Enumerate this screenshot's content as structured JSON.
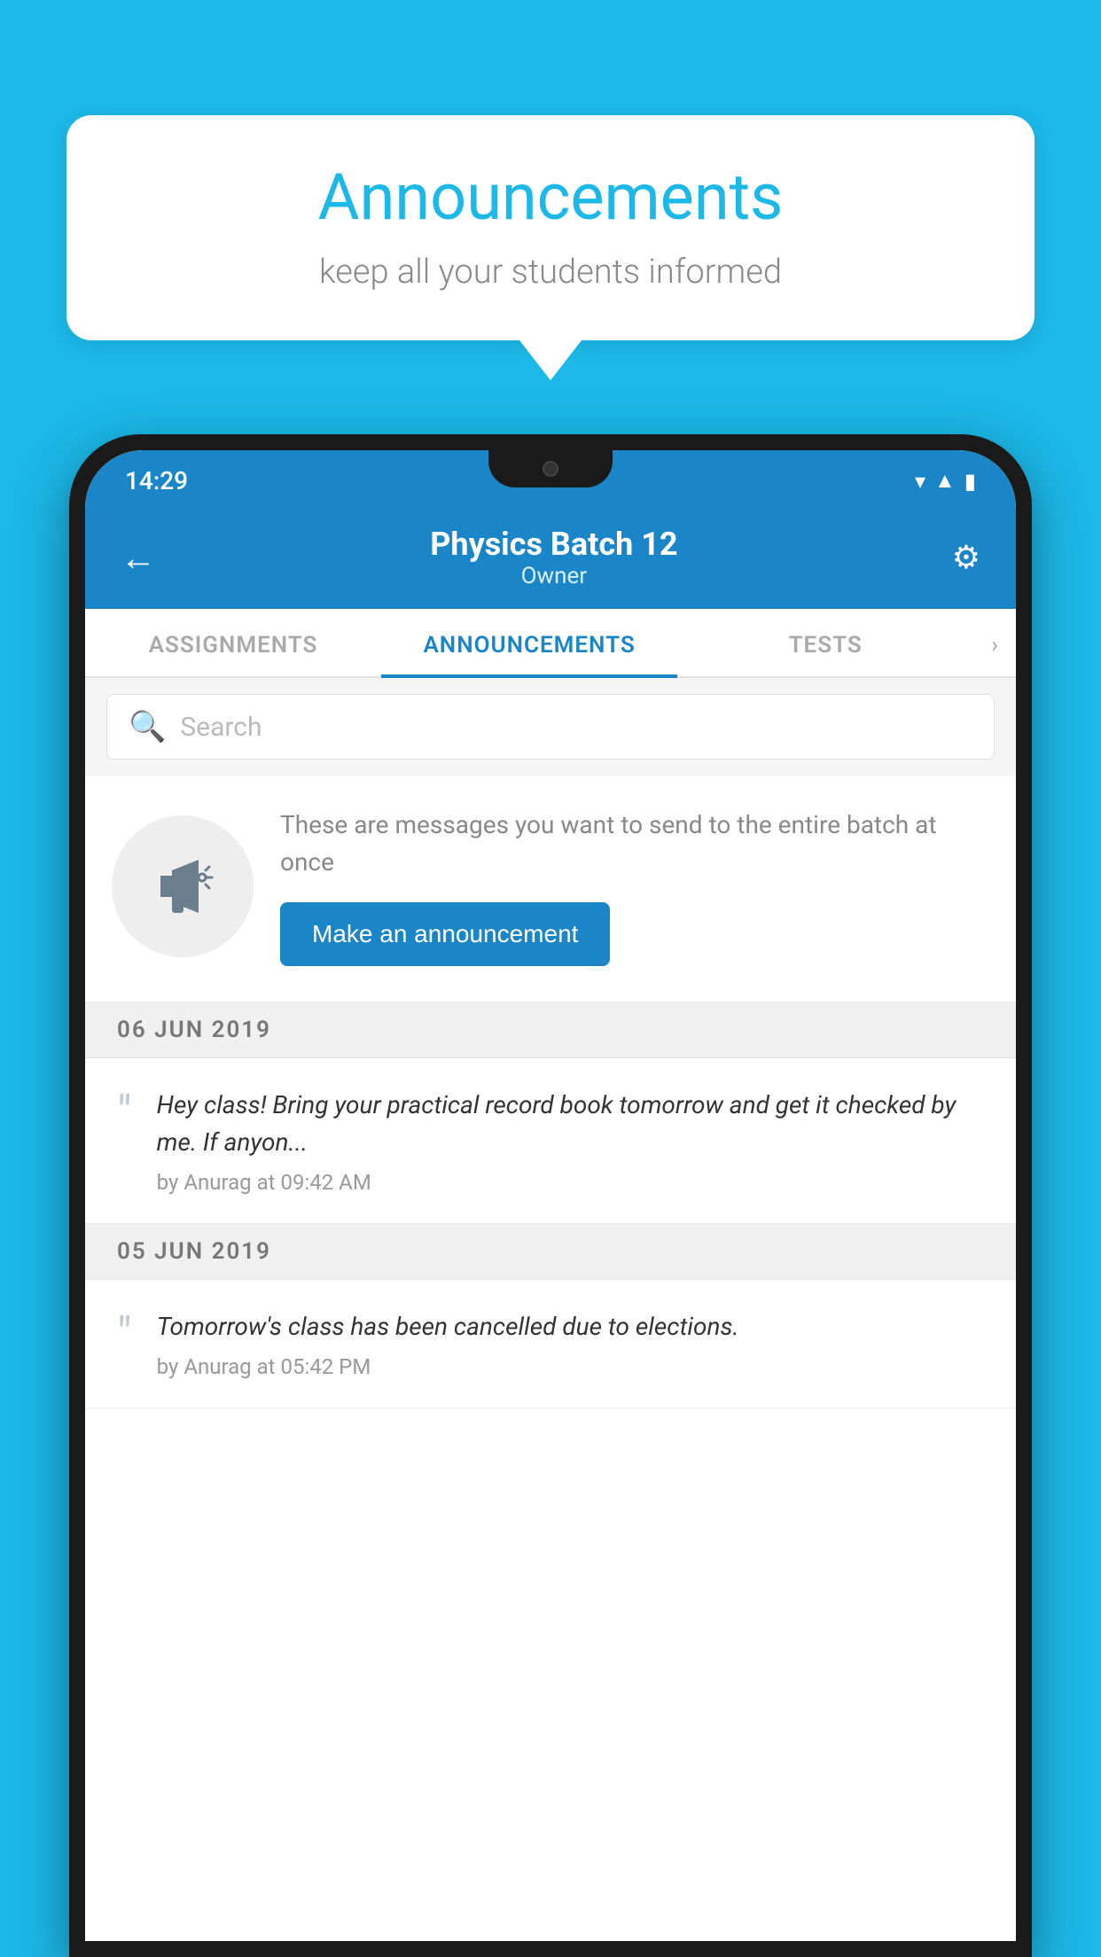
{
  "background_color": "#1cb8e8",
  "speech_bubble": {
    "title": "Announcements",
    "subtitle": "keep all your students informed"
  },
  "status_bar": {
    "time": "14:29",
    "icons": [
      "wifi",
      "signal",
      "battery"
    ]
  },
  "app_bar": {
    "title": "Physics Batch 12",
    "subtitle": "Owner",
    "back_label": "←",
    "gear_label": "⚙"
  },
  "tabs": [
    {
      "label": "ASSIGNMENTS",
      "active": false
    },
    {
      "label": "ANNOUNCEMENTS",
      "active": true
    },
    {
      "label": "TESTS",
      "active": false
    },
    {
      "label": "›",
      "active": false
    }
  ],
  "search": {
    "placeholder": "Search"
  },
  "promo_card": {
    "description": "These are messages you want to send to the entire batch at once",
    "button_label": "Make an announcement"
  },
  "announcements": [
    {
      "date": "06  JUN  2019",
      "items": [
        {
          "text": "Hey class! Bring your practical record book tomorrow and get it checked by me. If anyon...",
          "meta": "by Anurag at 09:42 AM"
        }
      ]
    },
    {
      "date": "05  JUN  2019",
      "items": [
        {
          "text": "Tomorrow's class has been cancelled due to elections.",
          "meta": "by Anurag at 05:42 PM"
        }
      ]
    }
  ]
}
